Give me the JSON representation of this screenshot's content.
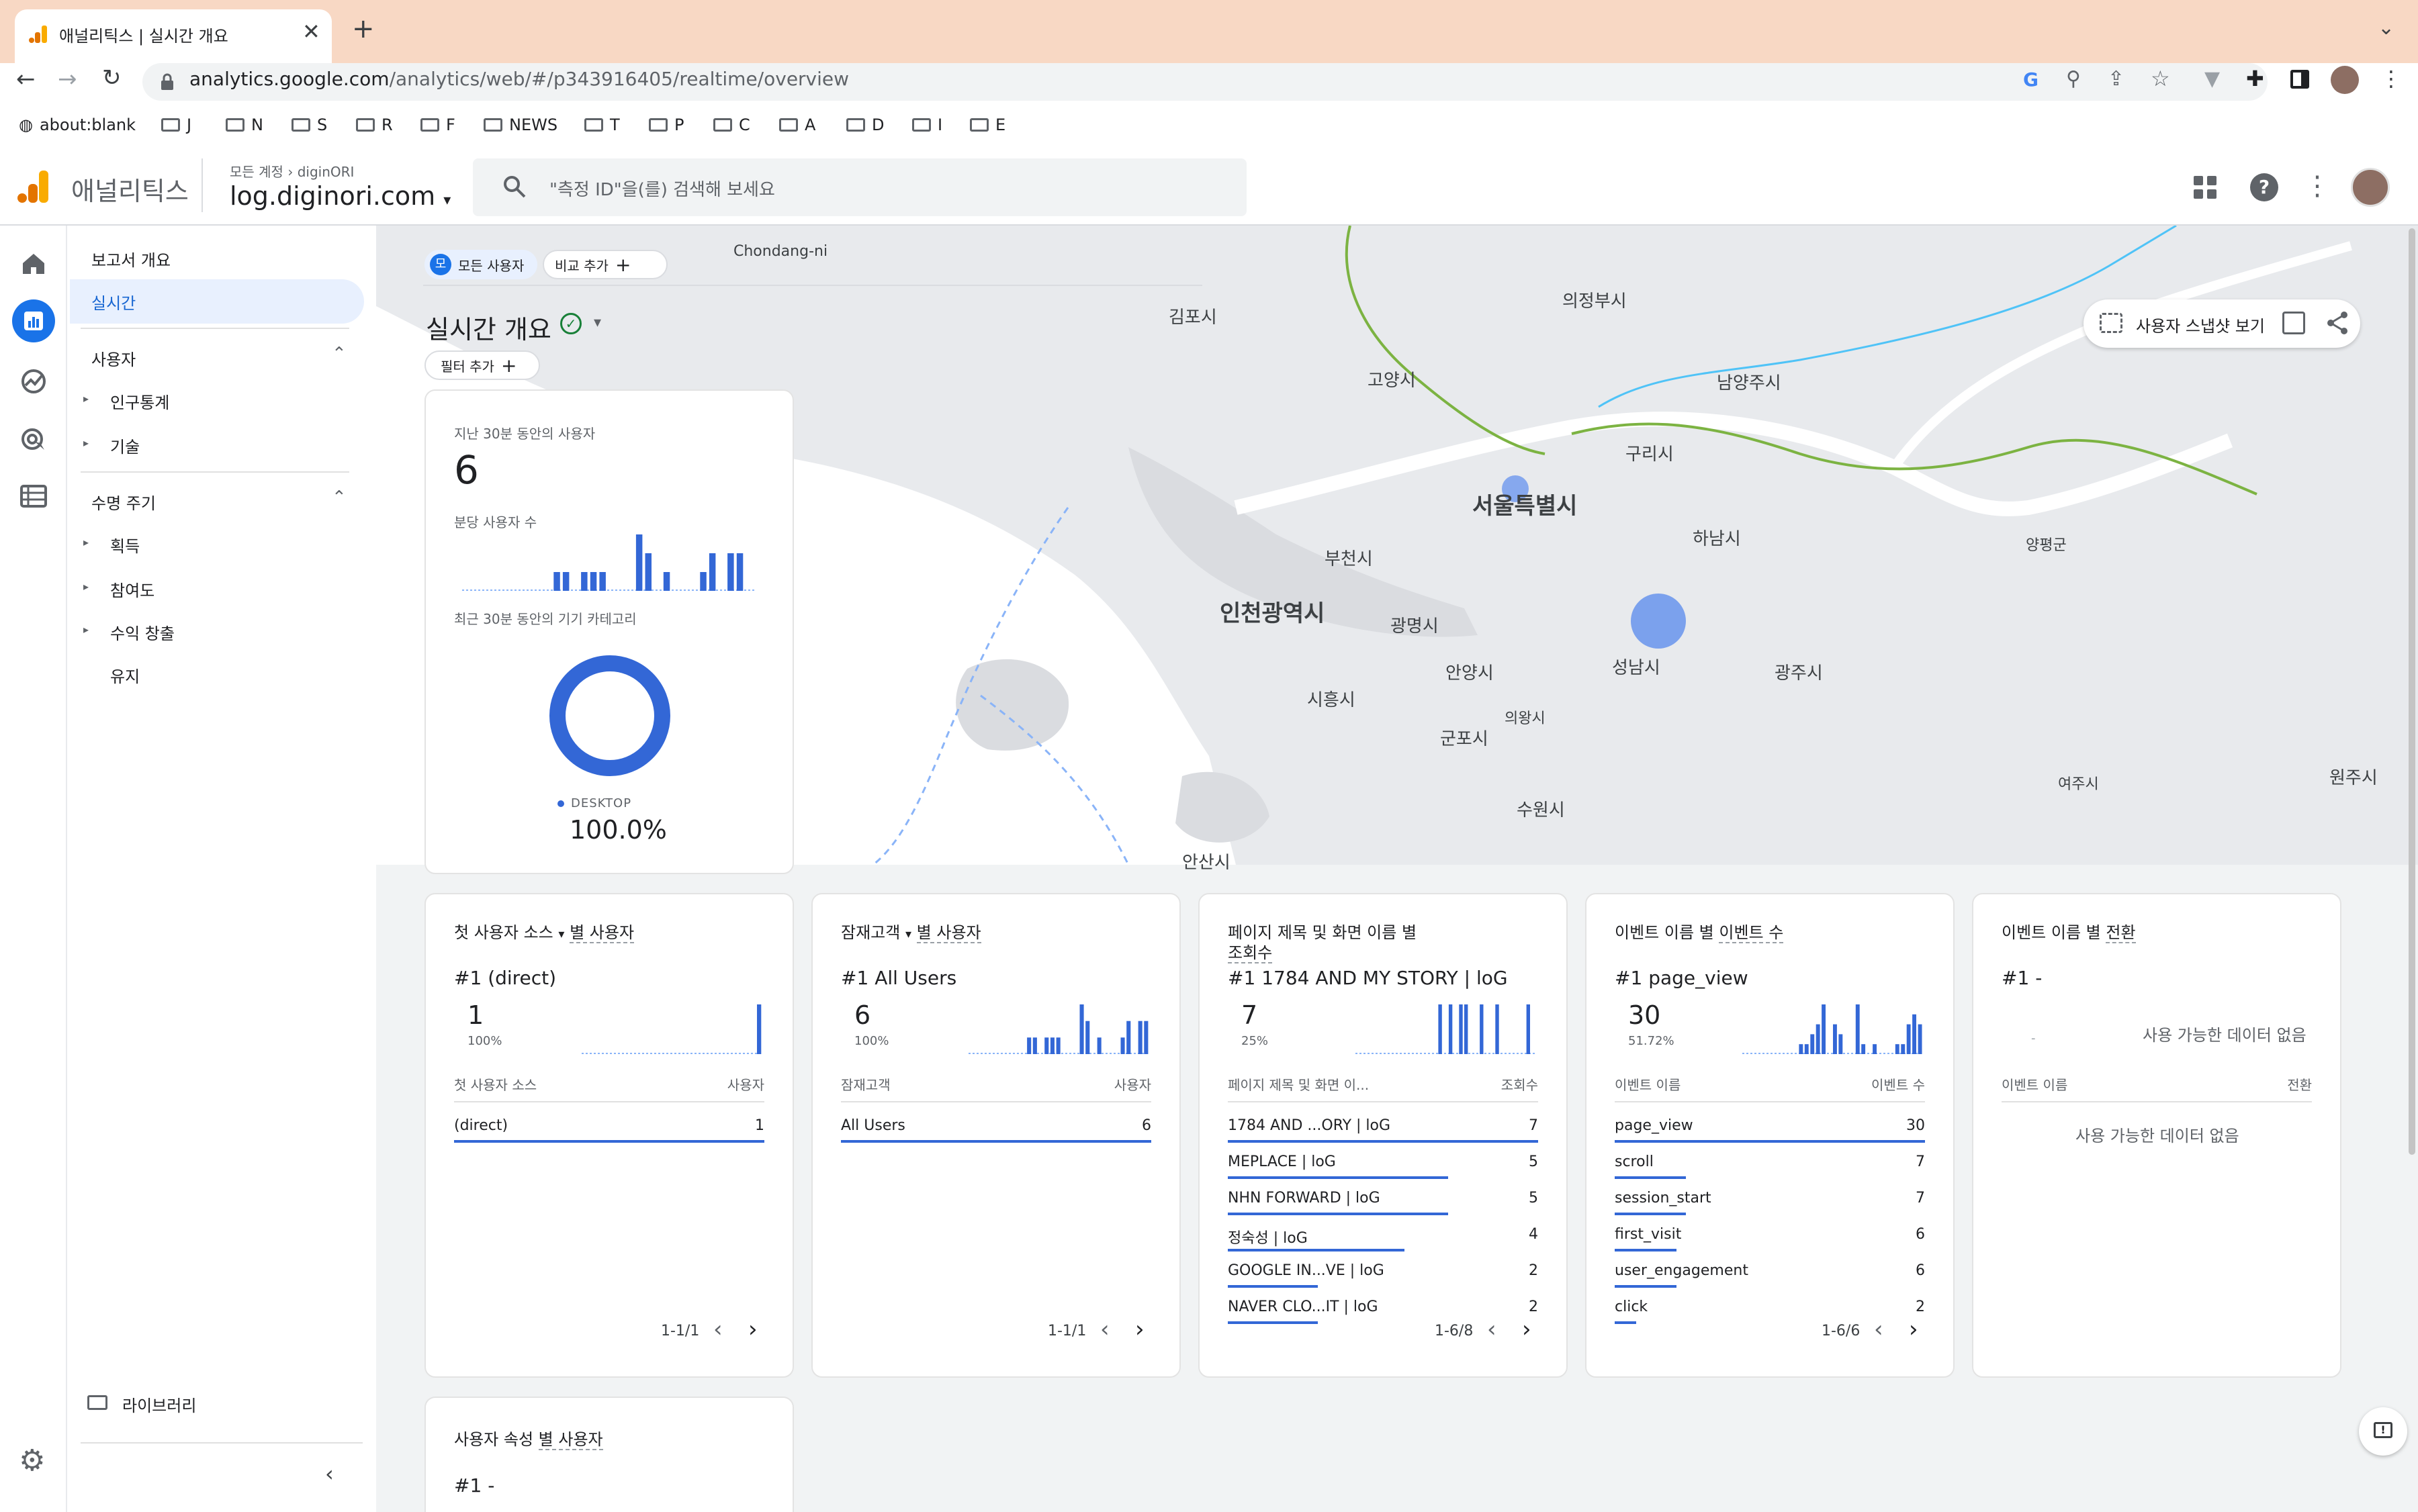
{
  "browser": {
    "tab_title": "애널리틱스 | 실시간 개요",
    "new_tab": "+",
    "url_domain": "analytics.google.com",
    "url_path": "/analytics/web/#/p343916405/realtime/overview",
    "bookmarks": [
      "about:blank",
      "J",
      "N",
      "S",
      "R",
      "F",
      "NEWS",
      "T",
      "P",
      "C",
      "A",
      "D",
      "I",
      "E"
    ]
  },
  "ga": {
    "product": "애널리틱스",
    "breadcrumb_all": "모든 계정",
    "breadcrumb_account": "diginORI",
    "property": "log.diginori.com",
    "search_placeholder": "\"측정 ID\"을(를) 검색해 보세요"
  },
  "nav": {
    "reports_overview": "보고서 개요",
    "realtime": "실시간",
    "section_user": "사용자",
    "demographics": "인구통계",
    "tech": "기술",
    "section_lifecycle": "수명 주기",
    "acquisition": "획득",
    "engagement": "참여도",
    "monetization": "수익 창출",
    "retention": "유지",
    "library": "라이브러리"
  },
  "realtime": {
    "segment_badge": "모",
    "segment_label": "모든 사용자",
    "compare_label": "비교 추가",
    "page_title": "실시간 개요",
    "filter_label": "필터 추가",
    "snapshot_label": "사용자 스냅샷 보기"
  },
  "map_labels": {
    "chondang": "Chondang-ni",
    "gimpo": "김포시",
    "uijeongbu": "의정부시",
    "goyang": "고양시",
    "namyang": "남양주시",
    "guri": "구리시",
    "seoul": "서울특별시",
    "bucheon": "부천시",
    "hanam": "하남시",
    "yangpyeong": "양평군",
    "incheon": "인천광역시",
    "gwangmyeong": "광명시",
    "anyang": "안양시",
    "seongnam": "성남시",
    "gwangju": "광주시",
    "siheung": "시흥시",
    "uiwang": "의왕시",
    "gunpo": "군포시",
    "suwon": "수원시",
    "yeoju": "여주시",
    "wonju": "원주시",
    "ansan": "안산시"
  },
  "summary_card": {
    "users_label": "지난 30분 동안의 사용자",
    "users_value": "6",
    "per_min_label": "분당 사용자 수",
    "device_label": "최근 30분 동안의 기기 카테고리",
    "device_name": "DESKTOP",
    "device_pct": "100.0%",
    "device_share": 1.0,
    "per_min_values": [
      0,
      0,
      0,
      0,
      0,
      0,
      0,
      0,
      0,
      0,
      1,
      1,
      0,
      1,
      1,
      1,
      0,
      0,
      0,
      3,
      2,
      0,
      1,
      0,
      0,
      0,
      1,
      2,
      0,
      2,
      2,
      0
    ]
  },
  "cards": [
    {
      "title": "첫 사용자 소스",
      "title_suffix": "별 사용자",
      "has_dropdown": true,
      "top_rank": "#1",
      "top_name": "(direct)",
      "top_value": "1",
      "top_pct": "100%",
      "spark": [
        0,
        0,
        0,
        0,
        0,
        0,
        0,
        0,
        0,
        0,
        0,
        0,
        0,
        0,
        0,
        0,
        0,
        0,
        0,
        0,
        0,
        0,
        0,
        0,
        0,
        0,
        0,
        0,
        0,
        1
      ],
      "col1": "첫 사용자 소스",
      "col2": "사용자",
      "rows": [
        {
          "name": "(direct)",
          "value": "1",
          "share": 1.0
        }
      ],
      "pager": "1-1/1"
    },
    {
      "title": "잠재고객",
      "title_suffix": "별 사용자",
      "has_dropdown": true,
      "top_rank": "#1",
      "top_name": "All Users",
      "top_value": "6",
      "top_pct": "100%",
      "spark": [
        0,
        0,
        0,
        0,
        0,
        0,
        0,
        0,
        0,
        0,
        1,
        1,
        0,
        1,
        1,
        1,
        0,
        0,
        0,
        3,
        2,
        0,
        1,
        0,
        0,
        0,
        1,
        2,
        0,
        2,
        2
      ],
      "col1": "잠재고객",
      "col2": "사용자",
      "rows": [
        {
          "name": "All Users",
          "value": "6",
          "share": 1.0
        }
      ],
      "pager": "1-1/1"
    },
    {
      "title": "페이지 제목 및 화면 이름 별",
      "title_suffix": "조회수",
      "has_dropdown": false,
      "top_rank": "#1",
      "top_name": "1784 AND MY STORY | loG",
      "top_value": "7",
      "top_pct": "25%",
      "spark": [
        0,
        0,
        0,
        0,
        0,
        0,
        0,
        0,
        0,
        0,
        0,
        0,
        0,
        0,
        0,
        0,
        1,
        0,
        1,
        0,
        1,
        1,
        0,
        0,
        1,
        0,
        0,
        1,
        0,
        0,
        0,
        0,
        0,
        1,
        0
      ],
      "col1": "페이지 제목 및 화면 이...",
      "col2": "조회수",
      "rows": [
        {
          "name": "1784 AND ...ORY | loG",
          "value": "7",
          "share": 1.0
        },
        {
          "name": "MEPLACE | loG",
          "value": "5",
          "share": 0.71
        },
        {
          "name": "NHN FORWARD | loG",
          "value": "5",
          "share": 0.71
        },
        {
          "name": "정숙성 | loG",
          "value": "4",
          "share": 0.57
        },
        {
          "name": "GOOGLE IN...VE | loG",
          "value": "2",
          "share": 0.29
        },
        {
          "name": "NAVER CLO...IT | loG",
          "value": "2",
          "share": 0.29
        }
      ],
      "pager": "1-6/8"
    },
    {
      "title": "이벤트 이름 별",
      "title_suffix": "이벤트 수",
      "has_dropdown": false,
      "top_rank": "#1",
      "top_name": "page_view",
      "top_value": "30",
      "top_pct": "51.72%",
      "spark": [
        0,
        0,
        0,
        0,
        0,
        0,
        0,
        0,
        0,
        0,
        1,
        1,
        2,
        3,
        5,
        0,
        3,
        2,
        0,
        0,
        5,
        1,
        0,
        1,
        0,
        0,
        0,
        1,
        1,
        3,
        4,
        3
      ],
      "col1": "이벤트 이름",
      "col2": "이벤트 수",
      "rows": [
        {
          "name": "page_view",
          "value": "30",
          "share": 1.0
        },
        {
          "name": "scroll",
          "value": "7",
          "share": 0.23
        },
        {
          "name": "session_start",
          "value": "7",
          "share": 0.23
        },
        {
          "name": "first_visit",
          "value": "6",
          "share": 0.2
        },
        {
          "name": "user_engagement",
          "value": "6",
          "share": 0.2
        },
        {
          "name": "click",
          "value": "2",
          "share": 0.07
        }
      ],
      "pager": "1-6/6"
    },
    {
      "title": "이벤트 이름 별",
      "title_suffix": "전환",
      "has_dropdown": false,
      "top_rank": "#1",
      "top_name": "-",
      "no_data": "사용 가능한 데이터 없음",
      "spark_dash": "-",
      "col1": "이벤트 이름",
      "col2": "전환",
      "rows": [],
      "pager": ""
    }
  ],
  "bottom_card": {
    "title": "사용자 속성",
    "title_suffix": "별 사용자",
    "top_rank": "#1",
    "top_name": "-"
  },
  "colors": {
    "accent": "#3367d6",
    "orange": "#f9ab00",
    "map_bg": "#e8eaed",
    "water": "#ffffff"
  }
}
